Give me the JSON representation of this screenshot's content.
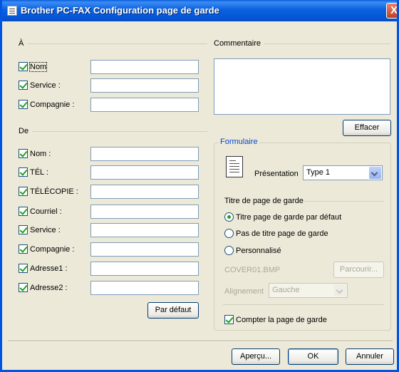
{
  "window": {
    "title": "Brother PC-FAX Configuration page de garde",
    "close_label": "X"
  },
  "to": {
    "heading": "À",
    "fields": [
      {
        "label": "Nom",
        "checked": true,
        "value": ""
      },
      {
        "label": "Service :",
        "checked": true,
        "value": ""
      },
      {
        "label": "Compagnie :",
        "checked": true,
        "value": ""
      }
    ]
  },
  "from": {
    "heading": "De",
    "fields": [
      {
        "label": "Nom :",
        "checked": true,
        "value": ""
      },
      {
        "label": "TÉL :",
        "checked": true,
        "value": ""
      },
      {
        "label": "TÉLÉCOPIE :",
        "checked": true,
        "value": ""
      },
      {
        "label": "Courriel :",
        "checked": true,
        "value": ""
      },
      {
        "label": "Service :",
        "checked": true,
        "value": ""
      },
      {
        "label": "Compagnie :",
        "checked": true,
        "value": ""
      },
      {
        "label": "Adresse1 :",
        "checked": true,
        "value": ""
      },
      {
        "label": "Adresse2 :",
        "checked": true,
        "value": ""
      }
    ],
    "default_button": "Par défaut"
  },
  "comment": {
    "heading": "Commentaire",
    "value": "",
    "clear_button": "Effacer"
  },
  "form": {
    "heading": "Formulaire",
    "presentation_label": "Présentation",
    "presentation_value": "Type 1",
    "cover_title_heading": "Titre de page de garde",
    "options": [
      {
        "label": "Titre page de garde par défaut",
        "selected": true
      },
      {
        "label": "Pas de titre page de garde",
        "selected": false
      },
      {
        "label": "Personnalisé",
        "selected": false
      }
    ],
    "file_name": "COVER01.BMP",
    "browse_button": "Parcourir...",
    "alignment_label": "Alignement",
    "alignment_value": "Gauche",
    "count_label": "Compter la page de garde",
    "count_checked": true
  },
  "footer": {
    "preview": "Aperçu...",
    "ok": "OK",
    "cancel": "Annuler"
  }
}
